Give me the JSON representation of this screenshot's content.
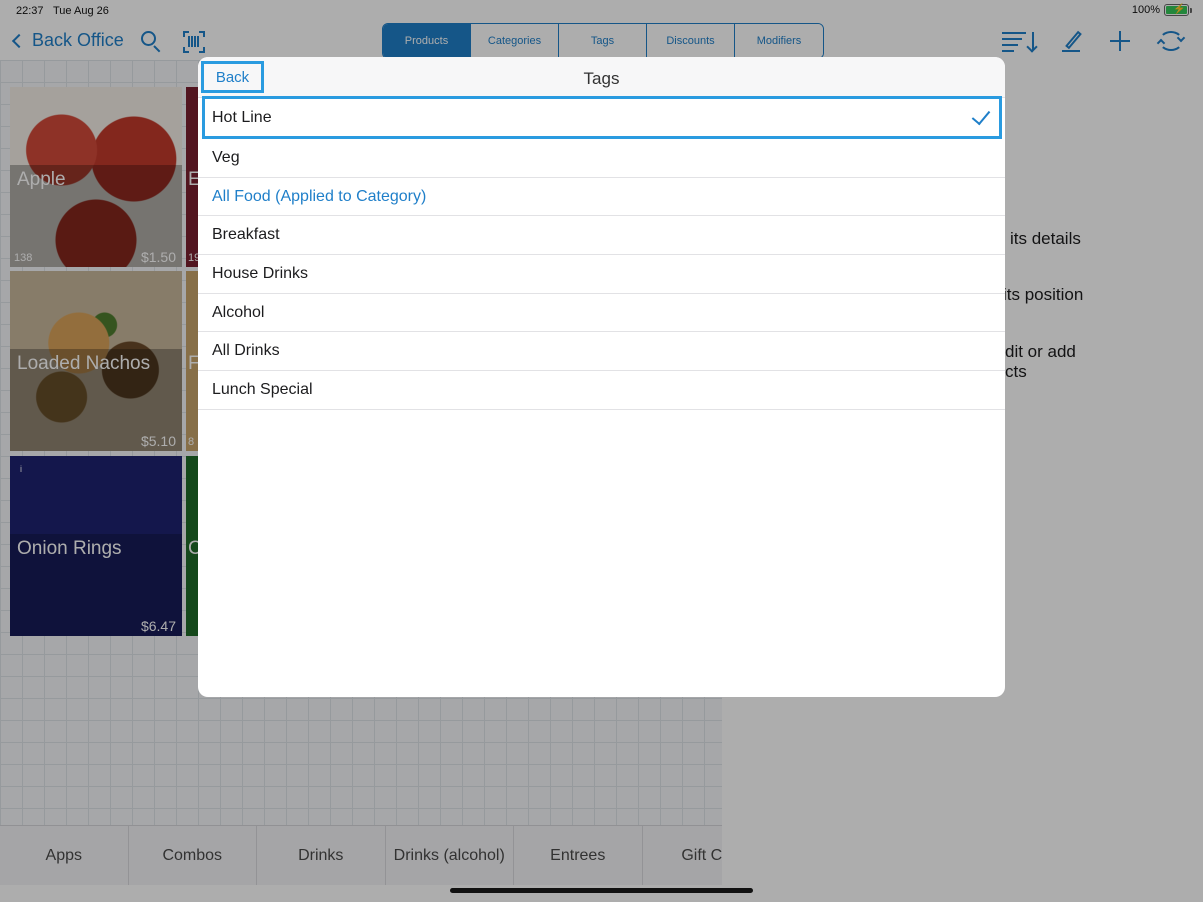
{
  "status_bar": {
    "time": "22:37",
    "date": "Tue Aug 26",
    "battery": "100%"
  },
  "nav": {
    "back_label": "Back Office",
    "tabs": [
      {
        "label": "Products",
        "active": true
      },
      {
        "label": "Categories",
        "active": false
      },
      {
        "label": "Tags",
        "active": false
      },
      {
        "label": "Discounts",
        "active": false
      },
      {
        "label": "Modifiers",
        "active": false
      }
    ]
  },
  "products": [
    {
      "name": "Apple",
      "count": "138",
      "price": "$1.50"
    },
    {
      "name": "Loaded Nachos",
      "count": "",
      "price": "$5.10"
    },
    {
      "name": "Onion Rings",
      "count": "",
      "price": "$6.47",
      "info": "i"
    }
  ],
  "partial_tiles": [
    {
      "letter": "E",
      "count": "19"
    },
    {
      "letter": "F",
      "count": "8"
    },
    {
      "letter": "C",
      "count": ""
    }
  ],
  "help_text": {
    "line1": "its details",
    "line2": "its position",
    "line3": "dit or add",
    "line4": "cts"
  },
  "categories_bar": [
    "Apps",
    "Combos",
    "Drinks",
    "Drinks (alcohol)",
    "Entrees",
    "Gift Ca"
  ],
  "modal": {
    "back_label": "Back",
    "title": "Tags",
    "tags": [
      {
        "label": "Hot  Line",
        "selected": true
      },
      {
        "label": "Veg",
        "selected": false
      },
      {
        "label": "All Food (Applied to Category)",
        "selected": false,
        "applied_to_category": true
      },
      {
        "label": "Breakfast",
        "selected": false
      },
      {
        "label": "House Drinks",
        "selected": false
      },
      {
        "label": "Alcohol",
        "selected": false
      },
      {
        "label": "All Drinks",
        "selected": false
      },
      {
        "label": "Lunch Special",
        "selected": false
      }
    ]
  },
  "colors": {
    "accent": "#1f7fc9",
    "highlight": "#2a9be0",
    "onion_rings_tile": "#1e2370"
  },
  "icons": [
    "chevron-left-icon",
    "search-icon",
    "barcode-scan-icon",
    "sort-icon",
    "edit-icon",
    "add-icon",
    "sync-icon",
    "checkmark-icon",
    "battery-icon"
  ]
}
